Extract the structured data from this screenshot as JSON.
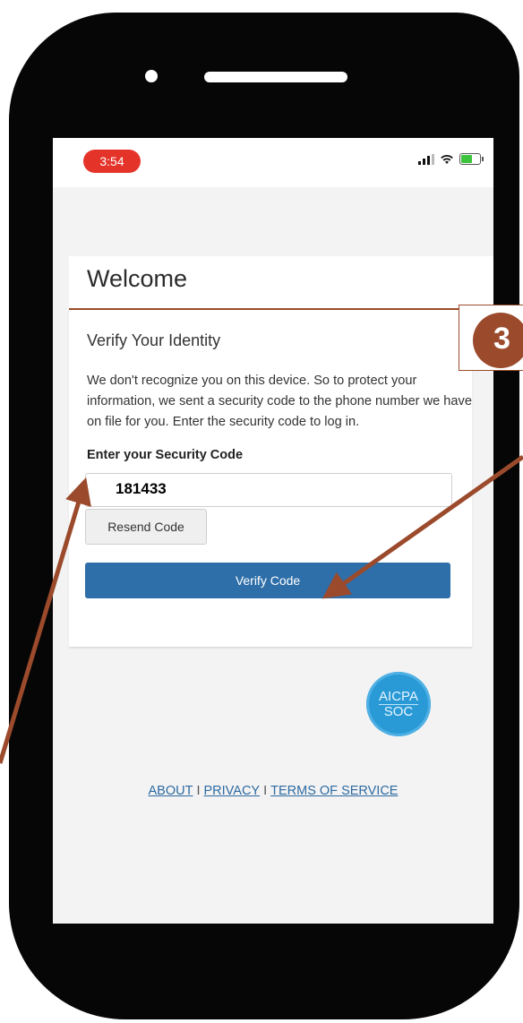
{
  "status_bar": {
    "time": "3:54"
  },
  "header": {
    "title": "Welcome"
  },
  "verify": {
    "title": "Verify Your Identity",
    "description": "We don't recognize you on this device. So to protect your information, we sent a security code to the phone number we have on file for you. Enter the security code to log in.",
    "code_label": "Enter your Security Code",
    "code_value": "181433",
    "resend_label": "Resend Code",
    "verify_label": "Verify Code"
  },
  "badge": {
    "top": "AICPA",
    "bottom": "SOC"
  },
  "footer": {
    "about": "ABOUT",
    "privacy": "PRIVACY",
    "terms": "TERMS OF SERVICE",
    "separator": "I"
  },
  "callout": {
    "number": "3"
  },
  "colors": {
    "accent_rust": "#9c4c2c",
    "button_blue": "#2f6fa9",
    "time_pill": "#e4342a"
  }
}
